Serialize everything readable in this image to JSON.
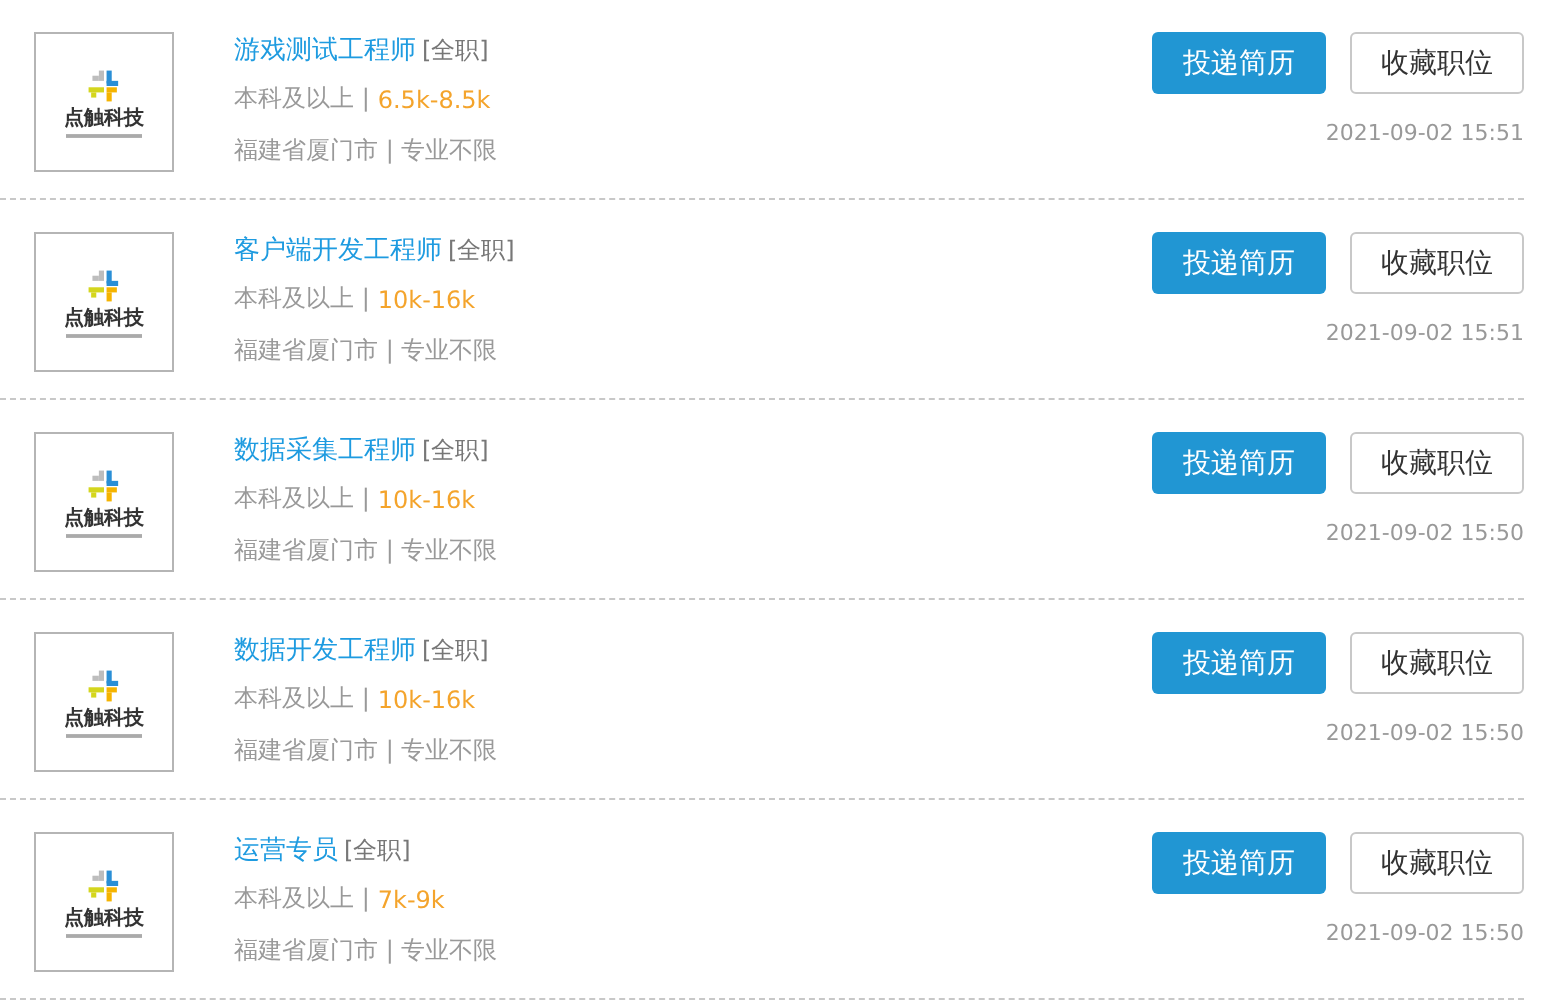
{
  "jobs": [
    {
      "logo_text": "点触科技",
      "title": "游戏测试工程师",
      "type": "[全职]",
      "education": "本科及以上 |",
      "salary": "6.5k-8.5k",
      "location": "福建省厦门市 | 专业不限",
      "apply": "投递简历",
      "save": "收藏职位",
      "date": "2021-09-02  15:51"
    },
    {
      "logo_text": "点触科技",
      "title": "客户端开发工程师",
      "type": "[全职]",
      "education": "本科及以上 |",
      "salary": "10k-16k",
      "location": "福建省厦门市 | 专业不限",
      "apply": "投递简历",
      "save": "收藏职位",
      "date": "2021-09-02  15:51"
    },
    {
      "logo_text": "点触科技",
      "title": "数据采集工程师",
      "type": "[全职]",
      "education": "本科及以上 |",
      "salary": "10k-16k",
      "location": "福建省厦门市 | 专业不限",
      "apply": "投递简历",
      "save": "收藏职位",
      "date": "2021-09-02  15:50"
    },
    {
      "logo_text": "点触科技",
      "title": "数据开发工程师",
      "type": "[全职]",
      "education": "本科及以上 |",
      "salary": "10k-16k",
      "location": "福建省厦门市 | 专业不限",
      "apply": "投递简历",
      "save": "收藏职位",
      "date": "2021-09-02  15:50"
    },
    {
      "logo_text": "点触科技",
      "title": "运营专员",
      "type": "[全职]",
      "education": "本科及以上 |",
      "salary": "7k-9k",
      "location": "福建省厦门市 | 专业不限",
      "apply": "投递简历",
      "save": "收藏职位",
      "date": "2021-09-02  15:50"
    }
  ]
}
